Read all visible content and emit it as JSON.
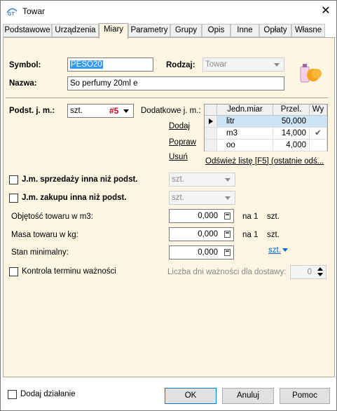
{
  "window": {
    "title": "Towar"
  },
  "tabs": [
    "Podstawowe",
    "Urządzenia",
    "Miary",
    "Parametry",
    "Grupy",
    "Opis",
    "Inne",
    "Opłaty",
    "Własne"
  ],
  "form": {
    "symbol_label": "Symbol:",
    "symbol_value": "PESO20",
    "rodzaj_label": "Rodzaj:",
    "rodzaj_value": "Towar",
    "nazwa_label": "Nazwa:",
    "nazwa_value": "So perfumy 20ml e"
  },
  "units": {
    "podst_label": "Podst. j. m.:",
    "podst_value": "szt.",
    "podst_badge": "#5",
    "dodatkowe_label": "Dodatkowe j. m.:",
    "actions": [
      "Dodaj",
      "Popraw",
      "Usuń"
    ],
    "grid_headers": [
      "Jedn.miar",
      "Przel.",
      "Wy"
    ],
    "grid_rows": [
      {
        "unit": "litr",
        "factor": "50,000",
        "check": ""
      },
      {
        "unit": "m3",
        "factor": "14,000",
        "check": "✔"
      },
      {
        "unit": "oo",
        "factor": "4,000",
        "check": ""
      }
    ],
    "refresh_link": "Odśwież listę [F5] (ostatnie odś..."
  },
  "options": {
    "sprzedazy_label": "J.m. sprzedaży inna niż podst.",
    "sprzedazy_value": "szt.",
    "zakupu_label": "J.m. zakupu inna niż podst.",
    "zakupu_value": "szt."
  },
  "measures": {
    "objetosc_label": "Objętość towaru w m3:",
    "objetosc_value": "0,000",
    "objetosc_per": "na 1",
    "objetosc_unit": "szt.",
    "masa_label": "Masa towaru w kg:",
    "masa_value": "0,000",
    "masa_per": "na 1",
    "masa_unit": "szt.",
    "stan_label": "Stan minimalny:",
    "stan_value": "0,000",
    "stan_unit_link": "szt."
  },
  "expiry": {
    "label": "Kontrola terminu ważności",
    "days_label": "Liczba dni ważności dla dostawy:",
    "days_value": "0"
  },
  "footer": {
    "dodaj_dzialanie": "Dodaj działanie",
    "ok": "OK",
    "cancel": "Anuluj",
    "help": "Pomoc"
  }
}
